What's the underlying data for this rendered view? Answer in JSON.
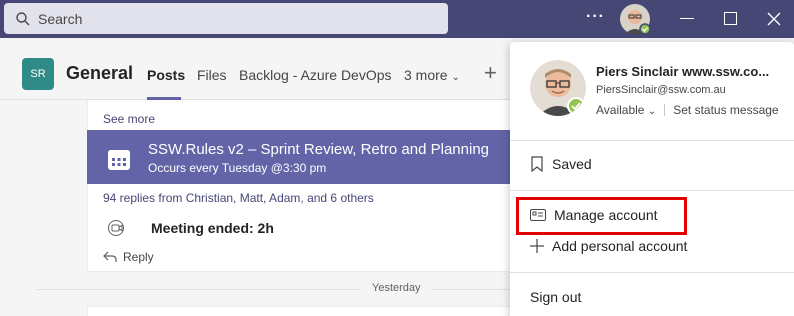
{
  "search": {
    "placeholder": "Search"
  },
  "header": {
    "team_initials": "SR",
    "channel_name": "General",
    "tabs": [
      "Posts",
      "Files",
      "Backlog - Azure DevOps",
      "3 more"
    ]
  },
  "posts": {
    "see_more": "See more",
    "meeting_title": "SSW.Rules v2 – Sprint Review, Retro and Planning",
    "meeting_schedule": "Occurs every Tuesday @3:30 pm",
    "replies": "94 replies from Christian, Matt, Adam, and 6 others",
    "meeting_ended": "Meeting ended: 2h",
    "reply": "Reply",
    "date_divider": "Yesterday"
  },
  "profile": {
    "name": "Piers Sinclair www.ssw.co...",
    "email": "PiersSinclair@ssw.com.au",
    "status": "Available",
    "set_status": "Set status message",
    "saved": "Saved",
    "manage_account": "Manage account",
    "add_personal": "Add personal account",
    "sign_out": "Sign out"
  },
  "colors": {
    "titlebar": "#464775",
    "accent": "#6264a7",
    "team_icon": "#2e8b86",
    "available": "#92c353",
    "highlight": "#e50000"
  }
}
